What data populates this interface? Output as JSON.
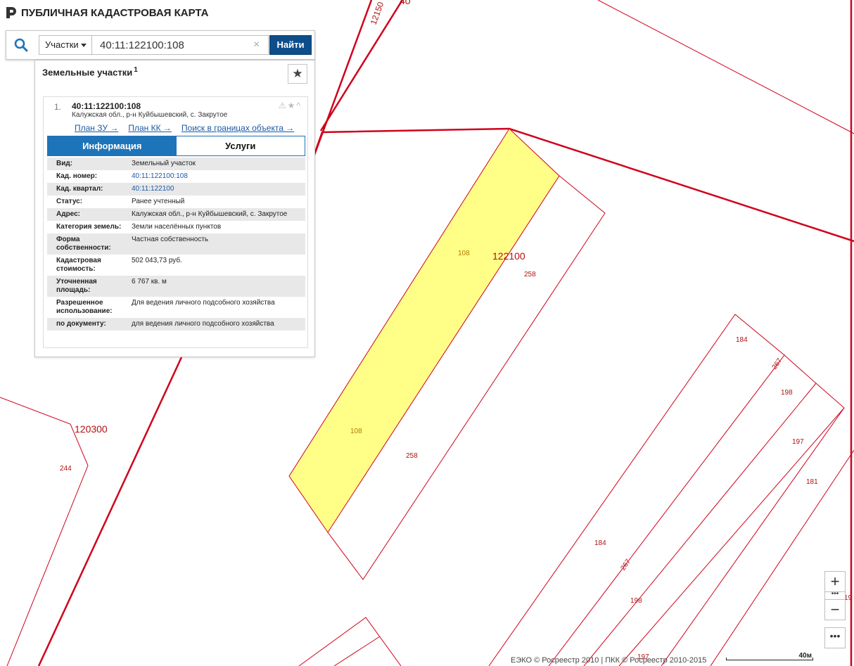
{
  "app": {
    "title": "ПУБЛИЧНАЯ КАДАСТРОВАЯ КАРТА"
  },
  "search": {
    "type_label": "Участки",
    "query": "40:11:122100:108",
    "button_label": "Найти"
  },
  "panel": {
    "header": "Земельные участки",
    "header_count": "1",
    "result": {
      "index": "1.",
      "title": "40:11:122100:108",
      "subtitle": "Калужская обл., р-н Куйбышевский, с. Закрутое",
      "links": [
        "План ЗУ →",
        "План КК →",
        "Поиск в границах объекта →"
      ],
      "tabs": {
        "info": "Информация",
        "services": "Услуги"
      },
      "rows": [
        {
          "k": "Вид:",
          "v": "Земельный участок"
        },
        {
          "k": "Кад. номер:",
          "v": "40:11:122100:108"
        },
        {
          "k": "Кад. квартал:",
          "v": "40:11:122100"
        },
        {
          "k": "Статус:",
          "v": "Ранее учтенный"
        },
        {
          "k": "Адрес:",
          "v": "Калужская обл., р-н Куйбышевский, с. Закрутое"
        },
        {
          "k": "Категория земель:",
          "v": "Земли населённых пунктов"
        },
        {
          "k": "Форма собственности:",
          "v": "Частная собственность"
        },
        {
          "k": "Кадастровая стоимость:",
          "v": "502 043,73 руб."
        },
        {
          "k": "Уточненная площадь:",
          "v": "6 767 кв. м"
        },
        {
          "k": "Разрешенное использование:",
          "v": "Для ведения личного подсобного хозяйства"
        },
        {
          "k": "по документу:",
          "v": "для ведения личного подсобного хозяйства"
        }
      ]
    }
  },
  "map": {
    "labels": {
      "l108a": "108",
      "l108b": "108",
      "l122100": "122100",
      "l258a": "258",
      "l258b": "258",
      "l120300": "120300",
      "l244": "244",
      "l184a": "184",
      "l267a": "267",
      "l198a": "198",
      "l197a": "197",
      "l181": "181",
      "l184b": "184",
      "l267b": "267",
      "l198b": "198",
      "l197b": "197",
      "l1215": "12150",
      "l40": "40",
      "l19": "19"
    },
    "colors": {
      "boundary": "#d0021b",
      "selected_fill": "#ffff88"
    }
  },
  "controls": {
    "zoom_in": "+",
    "zoom_out": "−",
    "dots": "•••",
    "more": "•••"
  },
  "footer": {
    "copyright": "ЕЭКО © Росреестр 2010 | ПКК © Росреестр 2010-2015",
    "scale_label": "40м"
  }
}
